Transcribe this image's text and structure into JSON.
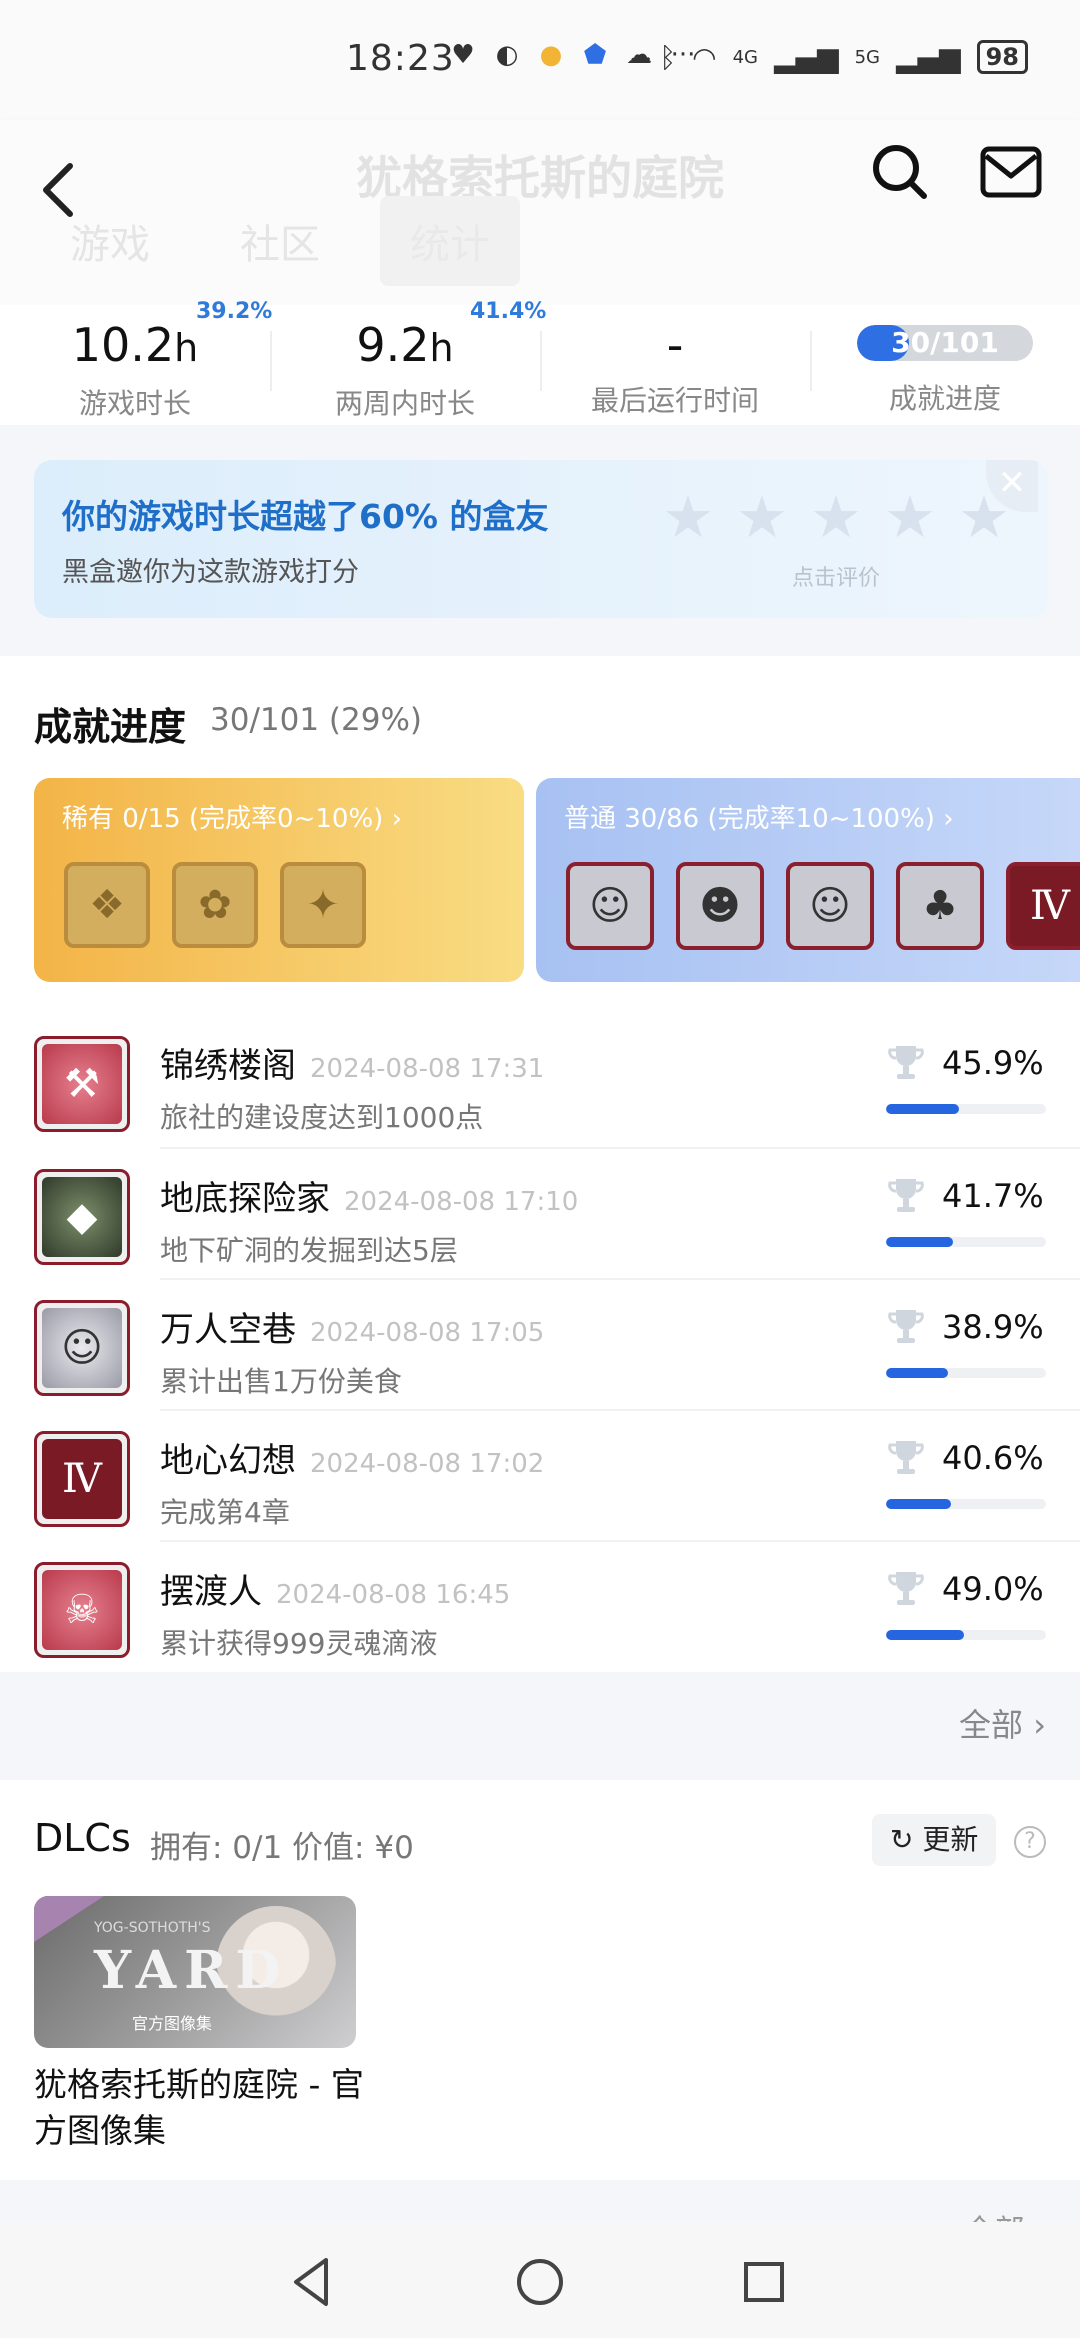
{
  "status_bar": {
    "time": "18:23",
    "battery": "98",
    "net1": "4G",
    "net2": "5G",
    "more": "···"
  },
  "header": {
    "title": "犹格索托斯的庭院",
    "tabs": [
      {
        "label": "游戏"
      },
      {
        "label": "社区"
      },
      {
        "label": "统计"
      }
    ]
  },
  "stats": [
    {
      "value": "10.2",
      "unit": "h",
      "label": "游戏时长",
      "percent": "39.2%"
    },
    {
      "value": "9.2",
      "unit": "h",
      "label": "两周内时长",
      "percent": "41.4%"
    },
    {
      "value": "-",
      "unit": "",
      "label": "最后运行时间",
      "percent": ""
    },
    {
      "value": "30/101",
      "unit": "",
      "label": "成就进度",
      "progress_fraction": 0.297
    }
  ],
  "rating_banner": {
    "headline": "你的游戏时长超越了60% 的盒友",
    "subtitle": "黑盒邀你为这款游戏打分",
    "hint": "点击评价",
    "close": "✕",
    "star_glyph": "★"
  },
  "achievements": {
    "title": "成就进度",
    "count": "30/101 (29%)",
    "rare_label": "稀有 0/15 (完成率0~10%) ›",
    "common_label": "普通 30/86 (完成率10~100%) ›",
    "list": [
      {
        "name": "锦绣楼阁",
        "date": "2024-08-08 17:31",
        "desc": "旅社的建设度达到1000点",
        "rate": "45.9%",
        "rate_value": 45.9,
        "icon": "hammer-icon"
      },
      {
        "name": "地底探险家",
        "date": "2024-08-08 17:10",
        "desc": "地下矿洞的发掘到达5层",
        "rate": "41.7%",
        "rate_value": 41.7,
        "icon": "cave-icon"
      },
      {
        "name": "万人空巷",
        "date": "2024-08-08 17:05",
        "desc": "累计出售1万份美食",
        "rate": "38.9%",
        "rate_value": 38.9,
        "icon": "maid-icon"
      },
      {
        "name": "地心幻想",
        "date": "2024-08-08 17:02",
        "desc": "完成第4章",
        "rate": "40.6%",
        "rate_value": 40.6,
        "icon": "chapter-iv-icon"
      },
      {
        "name": "摆渡人",
        "date": "2024-08-08 16:45",
        "desc": "累计获得999灵魂滴液",
        "rate": "49.0%",
        "rate_value": 49.0,
        "icon": "ghost-icon"
      }
    ],
    "all_link": "全部 ›"
  },
  "dlc": {
    "title": "DLCs",
    "meta": "拥有: 0/1 价值: ¥0",
    "refresh": "↻ 更新",
    "help": "?",
    "card_small": "YOG-SOTHOTH'S",
    "card_logo": "YARD",
    "card_caption": "官方图像集",
    "name": "犹格索托斯的庭院 - 官方图像集",
    "next_link": "全部 ›"
  },
  "colors": {
    "accent": "#2566e0",
    "rating_text": "#1f6fc9",
    "rare": "#f3b447",
    "common": "#a7c1f2"
  }
}
